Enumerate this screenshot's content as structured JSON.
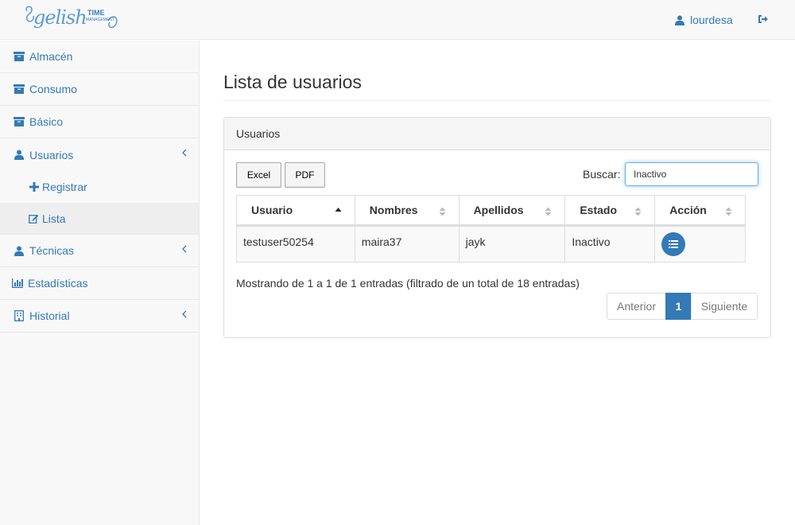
{
  "navbar": {
    "brand": "gelish",
    "brand_time": "TIME",
    "brand_sub": "MANAGEMENT",
    "user_name": "lourdesa",
    "user_icon": "user-icon",
    "logout_icon": "sign-out-icon"
  },
  "sidebar": {
    "items": [
      {
        "label": "Almacén",
        "icon": "archive-icon"
      },
      {
        "label": "Consumo",
        "icon": "archive-icon"
      },
      {
        "label": "Básico",
        "icon": "archive-icon"
      },
      {
        "label": "Usuarios",
        "icon": "user-icon",
        "expanded": true
      },
      {
        "label": "Técnicas",
        "icon": "user-icon"
      },
      {
        "label": "Estadísticas",
        "icon": "bar-chart-icon"
      },
      {
        "label": "Historial",
        "icon": "building-icon"
      }
    ],
    "subitems": [
      {
        "label": "Registrar",
        "icon": "plus-icon"
      },
      {
        "label": "Lista",
        "icon": "edit-icon",
        "active": true
      }
    ]
  },
  "main": {
    "title": "Lista de usuarios",
    "panel_title": "Usuarios",
    "buttons": {
      "excel": "Excel",
      "pdf": "PDF"
    },
    "search": {
      "label": "Buscar:",
      "value": "Inactivo"
    },
    "table": {
      "headers": [
        "Usuario",
        "Nombres",
        "Apellidos",
        "Estado",
        "Acción"
      ],
      "rows": [
        {
          "usuario": "testuser50254",
          "nombres": "maira37",
          "apellidos": "jayk",
          "estado": "Inactivo"
        }
      ]
    },
    "info": "Mostrando de 1 a 1 de 1 entradas (filtrado de un total de 18 entradas)",
    "pagination": {
      "prev": "Anterior",
      "current": "1",
      "next": "Siguiente"
    }
  },
  "colors": {
    "primary": "#337ab7",
    "sidebar_bg": "#f8f8f8",
    "border": "#ddd"
  }
}
